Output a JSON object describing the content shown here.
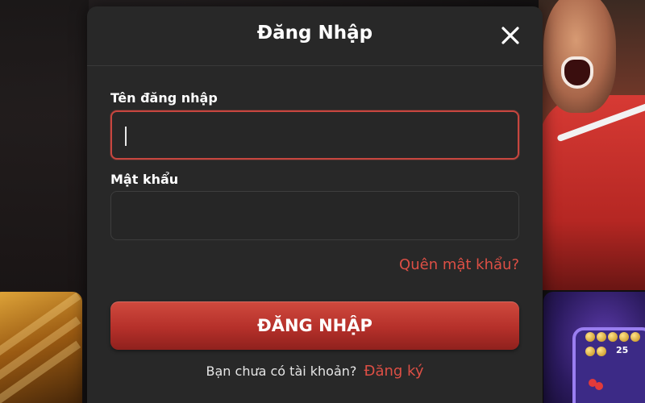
{
  "dialog": {
    "title": "Đăng Nhập",
    "close_icon": "close-icon"
  },
  "form": {
    "username_label": "Tên đăng nhập",
    "username_value": "",
    "password_label": "Mật khẩu",
    "password_value": "",
    "forgot_password": "Quên mật khẩu?",
    "submit_label": "ĐĂNG NHẬP",
    "register_prompt": "Bạn chưa có tài khoản?",
    "register_link": "Đăng ký"
  },
  "background": {
    "slot_number": "25"
  },
  "colors": {
    "dialog_bg": "#282828",
    "accent": "#dd4f45",
    "button": "#b5302a",
    "focused_border": "#c7463f"
  }
}
